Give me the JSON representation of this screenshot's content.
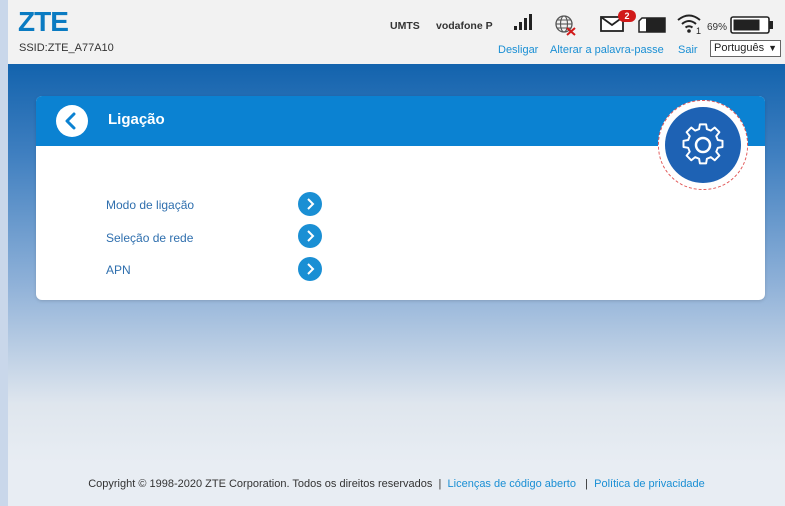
{
  "header": {
    "logo": "ZTE",
    "ssid": "SSID:ZTE_A77A10",
    "network_type": "UMTS",
    "carrier": "vodafone P",
    "messages_badge": "2",
    "wifi_clients": "1",
    "battery": "69%",
    "links": {
      "disconnect": "Desligar",
      "change_password": "Alterar a palavra-passe",
      "logout": "Sair"
    },
    "language": "Português"
  },
  "card": {
    "title": "Ligação",
    "items": [
      {
        "label": "Modo de ligação"
      },
      {
        "label": "Seleção de rede"
      },
      {
        "label": "APN"
      }
    ]
  },
  "footer": {
    "copyright": "Copyright © 1998-2020 ZTE Corporation. Todos os direitos reservados",
    "sep": "|",
    "open_source": "Licenças de código aberto",
    "privacy": "Política de privacidade"
  },
  "colors": {
    "brand": "#0a7bc2",
    "card_header": "#0b82d2",
    "link": "#1a8fd4",
    "badge": "#d11a1a"
  },
  "icons": [
    "signal-bars-icon",
    "globe-disconnected-icon",
    "mail-icon",
    "sim-card-icon",
    "wifi-icon",
    "battery-icon",
    "back-arrow-icon",
    "gear-icon",
    "chevron-right-icon"
  ]
}
